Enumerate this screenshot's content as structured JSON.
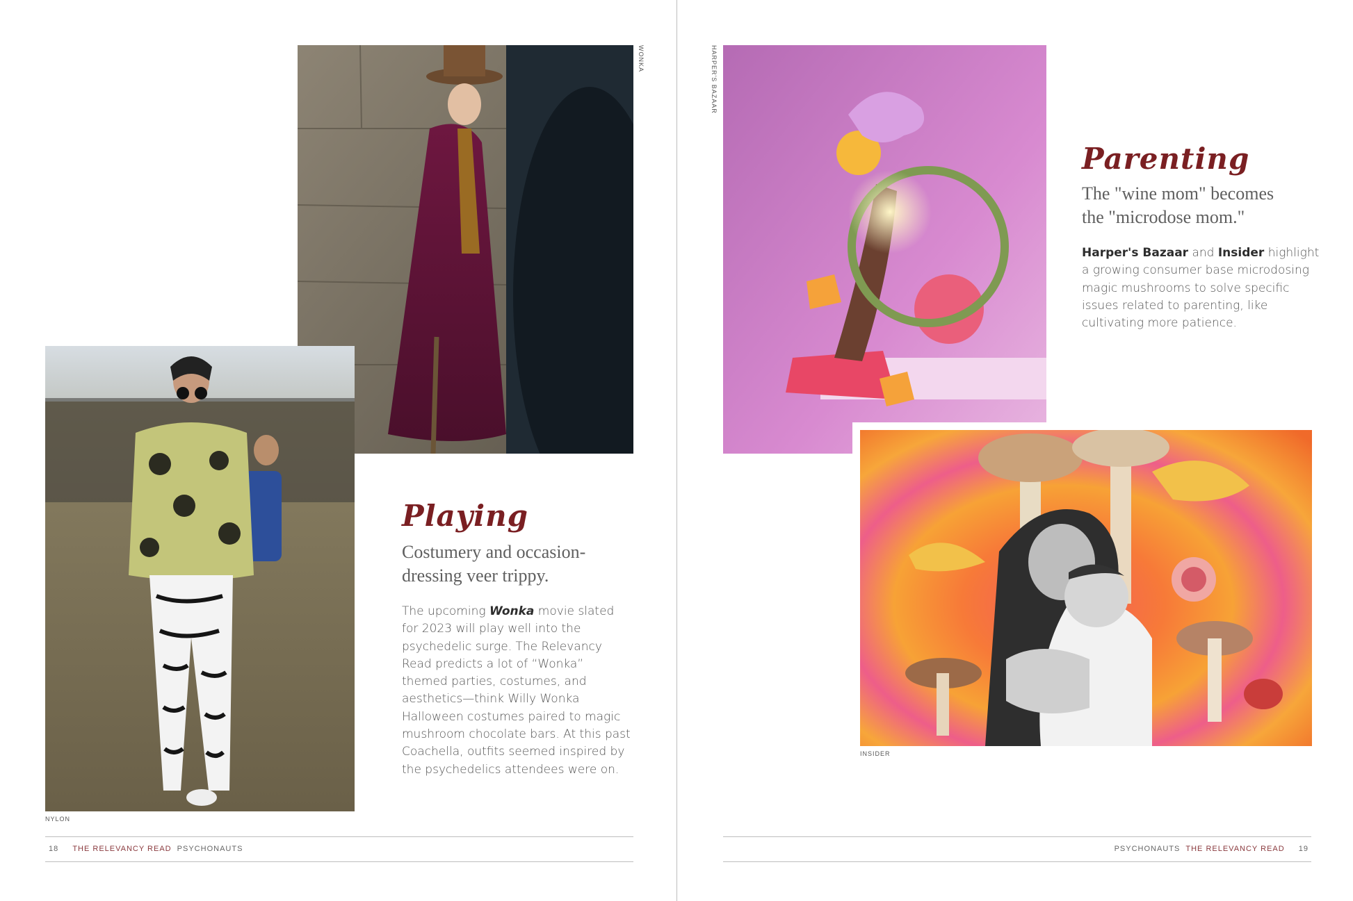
{
  "left_page": {
    "photo_top_credit": "WONKA",
    "photo_left_credit": "NYLON",
    "section_heading": "Playing",
    "section_subhead_line1": "Costumery and occasion-",
    "section_subhead_line2": "dressing veer trippy.",
    "body": {
      "l1_pre": "The upcoming ",
      "l1_em": "Wonka",
      "l1_post": " movie slated",
      "l2": "for 2023 will play well into the",
      "l3": "psychedelic surge. The Relevancy",
      "l4": "Read predicts a lot of “Wonka”",
      "l5": "themed parties, costumes, and",
      "l6": "aesthetics—think Willy Wonka",
      "l7": "Halloween costumes paired to magic",
      "l8": "mushroom chocolate bars. At this past",
      "l9": "Coachella, outfits seemed inspired by",
      "l10": "the psychedelics attendees were on."
    },
    "footer": {
      "page_number": "18",
      "brand": "THE RELEVANCY READ",
      "section": "PSYCHONAUTS"
    }
  },
  "right_page": {
    "photo_top_credit": "HARPER'S BAZAAR",
    "photo_bottom_credit": "INSIDER",
    "section_heading": "Parenting",
    "section_subhead_line1": "The \"wine mom\" becomes",
    "section_subhead_line2": "the \"microdose mom.\"",
    "body": {
      "l1_b1": "Harper's Bazaar",
      "l1_mid": " and ",
      "l1_b2": "Insider",
      "l1_post": " highlight",
      "l2": "a growing consumer base microdosing",
      "l3": "magic mushrooms to solve specific",
      "l4": "issues related to parenting, like",
      "l5": "cultivating more patience."
    },
    "footer": {
      "section": "PSYCHONAUTS",
      "brand": "THE RELEVANCY READ",
      "page_number": "19"
    }
  },
  "colors": {
    "accent": "#7a1f22",
    "rule": "#bdbdbd"
  }
}
